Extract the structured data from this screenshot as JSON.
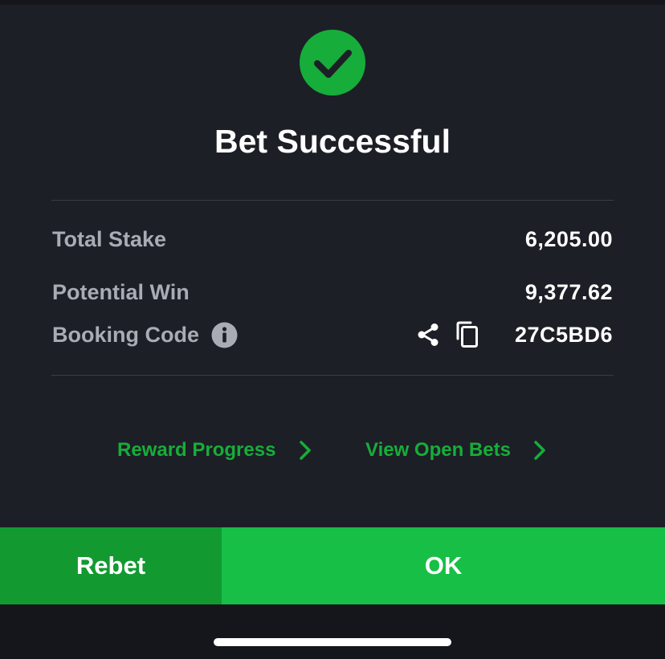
{
  "dialog": {
    "title": "Bet Successful",
    "icons": {
      "status": "check-icon",
      "info": "info-icon",
      "share": "share-icon",
      "copy": "copy-icon",
      "chevron": "chevron-right-icon"
    },
    "colors": {
      "background": "#1d1f26",
      "accent_green": "#16ad3a",
      "rebet_button": "#129a31",
      "ok_button": "#17bf47"
    }
  },
  "summary": {
    "total_stake_label": "Total Stake",
    "total_stake_value": "6,205.00",
    "potential_win_label": "Potential Win",
    "potential_win_value": "9,377.62",
    "booking_code_label": "Booking Code",
    "booking_code_value": "27C5BD6"
  },
  "links": {
    "reward_progress": "Reward Progress",
    "view_open_bets": "View Open Bets"
  },
  "actions": {
    "rebet": "Rebet",
    "ok": "OK"
  }
}
